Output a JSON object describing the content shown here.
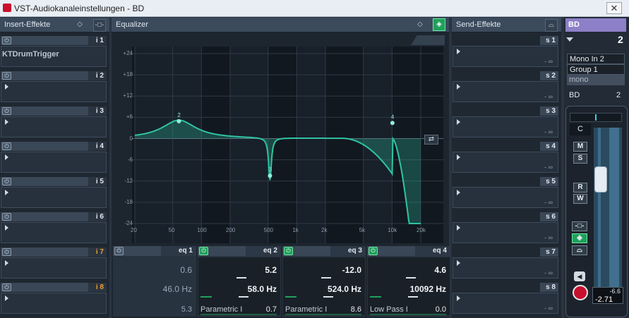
{
  "window": {
    "title": "VST-Audiokanaleinstellungen - BD",
    "close_glyph": "✕"
  },
  "insert": {
    "title": "Insert-Effekte",
    "slots": [
      {
        "label": "i 1",
        "plugin": "KTDrumTrigger",
        "orange": false
      },
      {
        "label": "i 2",
        "plugin": "",
        "orange": false
      },
      {
        "label": "i 3",
        "plugin": "",
        "orange": false
      },
      {
        "label": "i 4",
        "plugin": "",
        "orange": false
      },
      {
        "label": "i 5",
        "plugin": "",
        "orange": false
      },
      {
        "label": "i 6",
        "plugin": "",
        "orange": false
      },
      {
        "label": "i 7",
        "plugin": "",
        "orange": true
      },
      {
        "label": "i 8",
        "plugin": "",
        "orange": true
      }
    ]
  },
  "eq": {
    "title": "Equalizer",
    "y_ticks": [
      "+24",
      "+18",
      "+12",
      "+6",
      "0",
      "-6",
      "-12",
      "-18",
      "-24"
    ],
    "x_ticks": [
      "20",
      "50",
      "100",
      "200",
      "500",
      "1k",
      "2k",
      "5k",
      "10k",
      "20k"
    ],
    "bands": [
      {
        "label": "eq 1",
        "on": false,
        "gain": "0.6",
        "freq": "46.0 Hz",
        "q": "5.3",
        "type": "",
        "marker": ""
      },
      {
        "label": "eq 2",
        "on": true,
        "gain": "5.2",
        "freq": "58.0 Hz",
        "q": "0.7",
        "type": "Parametric I",
        "marker": "2"
      },
      {
        "label": "eq 3",
        "on": true,
        "gain": "-12.0",
        "freq": "524.0 Hz",
        "q": "8.6",
        "type": "Parametric I",
        "marker": "3"
      },
      {
        "label": "eq 4",
        "on": true,
        "gain": "4.6",
        "freq": "10092 Hz",
        "q": "0.0",
        "type": "Low Pass I",
        "marker": "4"
      }
    ],
    "accent": "#2fc4a4"
  },
  "send": {
    "title": "Send-Effekte",
    "inf_label": "- ∞",
    "slots": [
      "s 1",
      "s 2",
      "s 3",
      "s 4",
      "s 5",
      "s 6",
      "s 7",
      "s 8"
    ]
  },
  "channel": {
    "name": "BD",
    "number": "2",
    "routing": [
      "Mono In 2",
      "Group 1"
    ],
    "mode": "mono",
    "name_row": "BD",
    "name_row_num": "2",
    "pan": "C",
    "btn_m": "M",
    "btn_s": "S",
    "btn_r": "R",
    "btn_w": "W",
    "level_top": "-6.6",
    "level_bottom": "-2.71"
  }
}
